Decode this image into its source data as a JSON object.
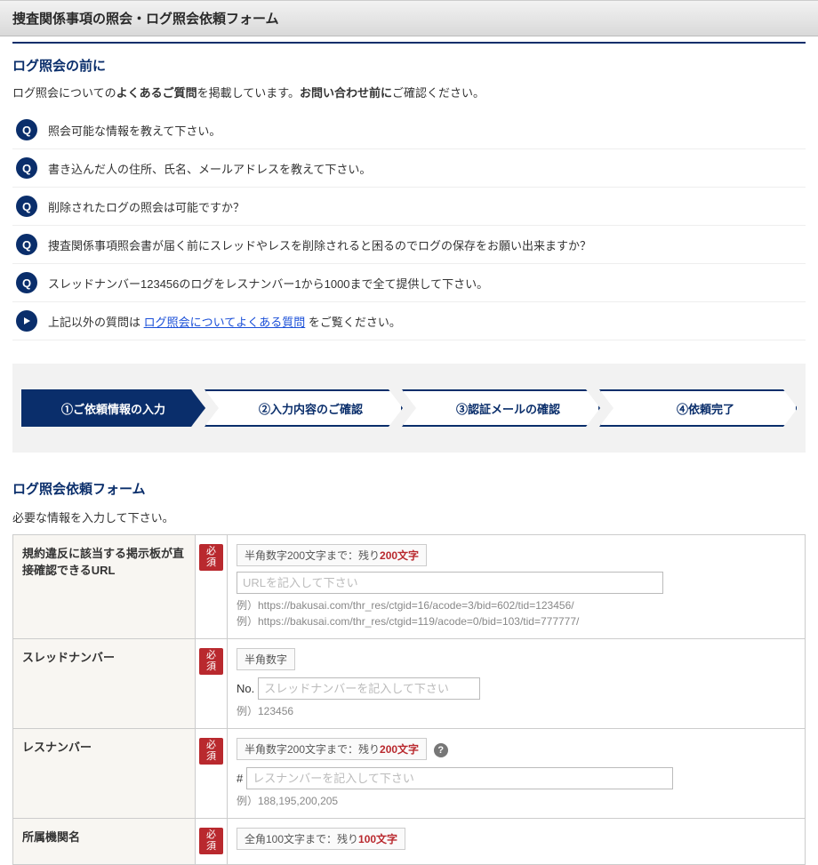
{
  "header": {
    "title": "捜査関係事項の照会・ログ照会依頼フォーム"
  },
  "before": {
    "title": "ログ照会の前に",
    "intro_a": "ログ照会についての",
    "intro_b": "よくあるご質問",
    "intro_c": "を掲載しています。",
    "intro_d": "お問い合わせ前に",
    "intro_e": "ご確認ください。"
  },
  "faq": {
    "q_label": "Q",
    "items": [
      "照会可能な情報を教えて下さい。",
      "書き込んだ人の住所、氏名、メールアドレスを教えて下さい。",
      "削除されたログの照会は可能ですか？",
      "捜査関係事項照会書が届く前にスレッドやレスを削除されると困るのでログの保存をお願い出来ますか？",
      "スレッドナンバー123456のログをレスナンバー1から1000まで全て提供して下さい。"
    ],
    "more_prefix": "上記以外の質問は ",
    "more_link": "ログ照会についてよくある質問",
    "more_suffix": " をご覧ください。"
  },
  "steps": [
    "①ご依頼情報の入力",
    "②入力内容のご確認",
    "③認証メールの確認",
    "④依頼完了"
  ],
  "form": {
    "title": "ログ照会依頼フォーム",
    "intro": "必要な情報を入力して下さい。",
    "required_label": "必須",
    "rows": {
      "url": {
        "label": "規約違反に該当する掲示板が直接確認できるURL",
        "hint_pre": "半角数字200文字まで：残り",
        "hint_count": "200文字",
        "placeholder": "URLを記入して下さい",
        "example": "例）https://bakusai.com/thr_res/ctgid=16/acode=3/bid=602/tid=123456/\n例）https://bakusai.com/thr_res/ctgid=119/acode=0/bid=103/tid=777777/"
      },
      "thread": {
        "label": "スレッドナンバー",
        "hint": "半角数字",
        "prefix": "No.",
        "placeholder": "スレッドナンバーを記入して下さい",
        "example": "例）123456"
      },
      "res": {
        "label": "レスナンバー",
        "hint_pre": "半角数字200文字まで：残り",
        "hint_count": "200文字",
        "prefix": "#",
        "placeholder": "レスナンバーを記入して下さい",
        "example": "例）188,195,200,205"
      },
      "org": {
        "label": "所属機関名",
        "hint_pre": "全角100文字まで：残り",
        "hint_count": "100文字"
      }
    }
  }
}
